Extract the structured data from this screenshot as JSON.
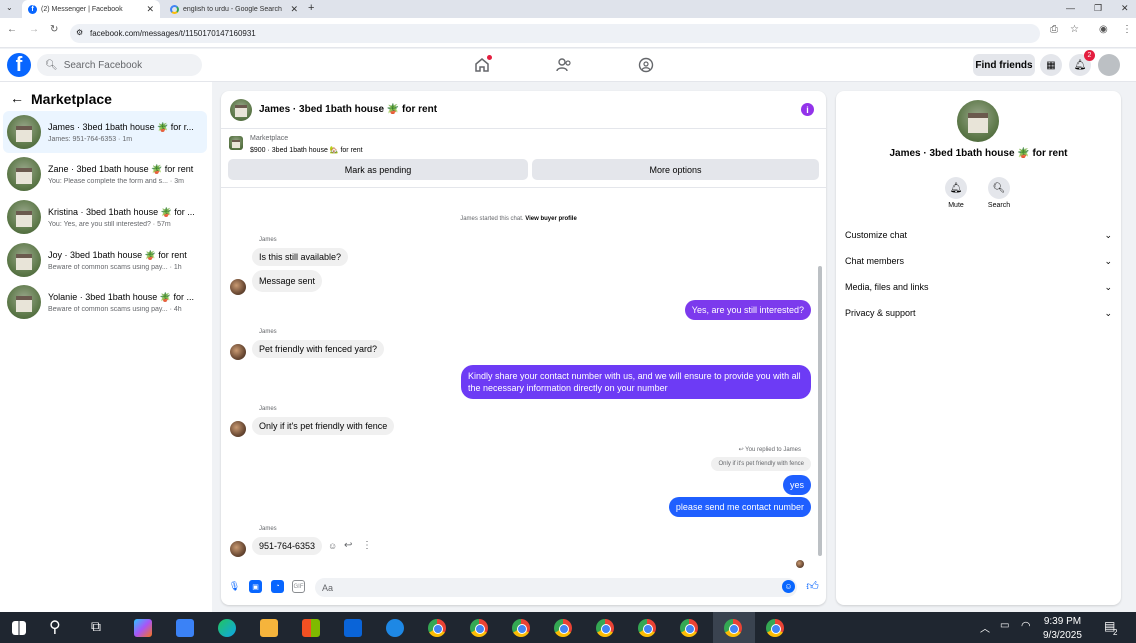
{
  "browser": {
    "tabs": [
      {
        "title": "(2) Messenger | Facebook",
        "active": true
      },
      {
        "title": "english to urdu - Google Search",
        "active": false
      }
    ],
    "new_tab": "+",
    "url": "facebook.com/messages/t/1150170147160931"
  },
  "fb_header": {
    "logo": "f",
    "search_placeholder": "Search Facebook",
    "find_friends": "Find friends",
    "notification_count": "2"
  },
  "sidebar": {
    "title": "Marketplace",
    "conversations": [
      {
        "name": "James · 3bed 1bath house 🪴 for r...",
        "preview": "James: 951-764-6353 · 1m",
        "selected": true
      },
      {
        "name": "Zane · 3bed 1bath house 🪴 for rent",
        "preview": "You: Please complete the form and s... · 3m",
        "selected": false
      },
      {
        "name": "Kristina · 3bed 1bath house 🪴 for ...",
        "preview": "You: Yes, are you still interested? · 57m",
        "selected": false
      },
      {
        "name": "Joy · 3bed 1bath house 🪴 for rent",
        "preview": "Beware of common scams using pay... · 1h",
        "selected": false
      },
      {
        "name": "Yolanie · 3bed 1bath house 🪴 for ...",
        "preview": "Beware of common scams using pay... · 4h",
        "selected": false
      }
    ]
  },
  "chat": {
    "title": "James · 3bed 1bath house 🪴 for rent",
    "info_icon": "i",
    "marketplace_label": "Marketplace",
    "listing": "$900 · 3bed 1bath house 🏡 for rent",
    "mark_pending": "Mark as pending",
    "more_options": "More options",
    "started_text": "James started this chat.",
    "view_buyer_profile": "View buyer profile",
    "sender_james": "James",
    "messages": {
      "m1": "Is this still available?",
      "m2": "Message sent",
      "m3": "Yes, are you still interested?",
      "m4": "Pet friendly with fenced yard?",
      "m5": "Kindly share your contact number with us, and we will ensure to provide you with all the necessary information directly on your number",
      "m6": "Only if it's pet friendly with fence",
      "reply_label": "You replied to James",
      "reply_quote": "Only if it's pet friendly with fence",
      "m7": "yes",
      "m8": "please send me contact number",
      "m9": "951-764-6353"
    },
    "composer_placeholder": "Aa"
  },
  "details": {
    "title": "James · 3bed 1bath house 🪴 for rent",
    "mute": "Mute",
    "search": "Search",
    "sections": [
      "Customize chat",
      "Chat members",
      "Media, files and links",
      "Privacy & support"
    ]
  },
  "taskbar": {
    "time": "9:39 PM",
    "date": "9/3/2025",
    "notif": "2"
  },
  "colors": {
    "fb_blue": "#0866ff",
    "outgoing_purple": "#7c3aed",
    "outgoing_blue": "#1f5fff"
  }
}
